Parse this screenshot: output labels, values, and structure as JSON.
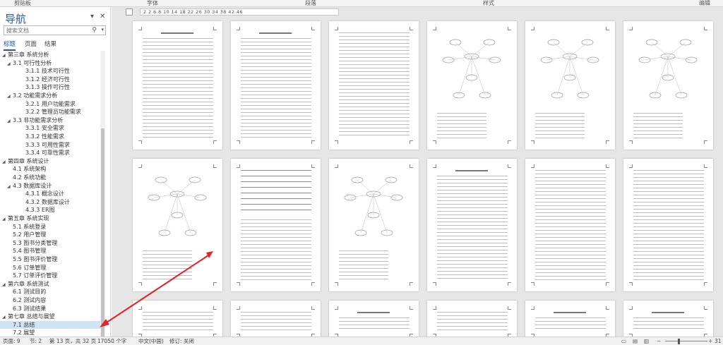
{
  "ribbon": {
    "groups": [
      "剪贴板",
      "字体",
      "段落",
      "样式",
      "编辑"
    ]
  },
  "nav": {
    "title": "导航",
    "search_placeholder": "搜索文档",
    "tabs": [
      "标题",
      "页面",
      "结果"
    ],
    "items": [
      {
        "level": 0,
        "label": "第三章 系统分析",
        "expanded": true
      },
      {
        "level": 1,
        "label": "3.1 可行性分析",
        "expanded": true
      },
      {
        "level": 2,
        "label": "3.1.1 技术可行性"
      },
      {
        "level": 2,
        "label": "3.1.2 经济可行性"
      },
      {
        "level": 2,
        "label": "3.1.3 操作可行性"
      },
      {
        "level": 1,
        "label": "3.2 功能需求分析",
        "expanded": true
      },
      {
        "level": 2,
        "label": "3.2.1 用户功能需求"
      },
      {
        "level": 2,
        "label": "3.2.2 管理员功能需求"
      },
      {
        "level": 1,
        "label": "3.3 非功能需求分析",
        "expanded": true
      },
      {
        "level": 2,
        "label": "3.3.1 安全需求"
      },
      {
        "level": 2,
        "label": "3.3.2 性能需求"
      },
      {
        "level": 2,
        "label": "3.3.3 可用性需求"
      },
      {
        "level": 2,
        "label": "3.3.4 可靠性需求"
      },
      {
        "level": 0,
        "label": "第四章 系统设计",
        "expanded": true
      },
      {
        "level": 1,
        "label": "4.1 系统架构"
      },
      {
        "level": 1,
        "label": "4.2 系统功能"
      },
      {
        "level": 1,
        "label": "4.3 数据库设计",
        "expanded": true
      },
      {
        "level": 2,
        "label": "4.3.1 概念设计"
      },
      {
        "level": 2,
        "label": "4.3.2 数据库设计"
      },
      {
        "level": 2,
        "label": "4.3.3 ER图"
      },
      {
        "level": 0,
        "label": "第五章 系统实现",
        "expanded": true
      },
      {
        "level": 1,
        "label": "5.1 系统登录"
      },
      {
        "level": 1,
        "label": "5.2 用户管理"
      },
      {
        "level": 1,
        "label": "5.3 图书分类管理"
      },
      {
        "level": 1,
        "label": "5.4 图书管理"
      },
      {
        "level": 1,
        "label": "5.5 图书评价管理"
      },
      {
        "level": 1,
        "label": "5.6 订单管理"
      },
      {
        "level": 1,
        "label": "5.7 订单评价管理"
      },
      {
        "level": 0,
        "label": "第六章 系统测试",
        "expanded": true
      },
      {
        "level": 1,
        "label": "6.1 测试目的"
      },
      {
        "level": 1,
        "label": "6.2 测试内容"
      },
      {
        "level": 1,
        "label": "6.3 测试结果"
      },
      {
        "level": 0,
        "label": "第七章 总结与展望",
        "expanded": true
      },
      {
        "level": 1,
        "label": "7.1 总结",
        "selected": true
      },
      {
        "level": 1,
        "label": "7.2 展望"
      }
    ]
  },
  "ruler": {
    "numbers": "2  2  6  8  10  14  18  22  26  30  34  38  42  46"
  },
  "pages": {
    "headings": [
      "1.1 项目背景和意义",
      "第二章  系统设计",
      "4.1 系统功能设计",
      "第五章  系统实现",
      "第六章  系统测试",
      "第七章  总结与展望"
    ]
  },
  "status": {
    "page": "页面: 9",
    "section": "节: 2",
    "page_of": "第 13 页，共 32 页",
    "words": "17050 个字",
    "lang": "中文(中国)",
    "track": "修订: 关闭",
    "zoom": "31"
  },
  "colors": {
    "accent": "#2b579a",
    "selection": "#cfe3f7",
    "annotation_arrow": "#e8202a"
  }
}
